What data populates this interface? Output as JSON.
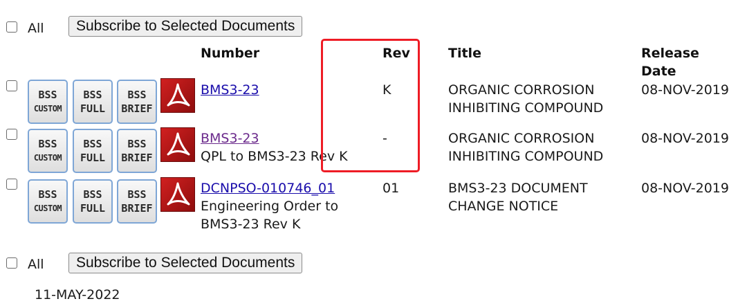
{
  "top": {
    "all_label": "All",
    "subscribe_label": "Subscribe to Selected Documents"
  },
  "headers": {
    "number": "Number",
    "rev": "Rev",
    "title": "Title",
    "release_date": "Release Date"
  },
  "bss_buttons": {
    "custom": {
      "line1": "BSS",
      "line2": "CUSTOM"
    },
    "full": {
      "line1": "BSS",
      "line2": "FULL"
    },
    "brief": {
      "line1": "BSS",
      "line2": "BRIEF"
    }
  },
  "rows": [
    {
      "number": "BMS3-23",
      "subtitle": "",
      "rev": "K",
      "title_line1": "ORGANIC CORROSION",
      "title_line2": "INHIBITING COMPOUND",
      "release_date": "08-NOV-2019"
    },
    {
      "number": "BMS3-23",
      "subtitle": "QPL to BMS3-23 Rev K",
      "rev": "-",
      "title_line1": "ORGANIC CORROSION",
      "title_line2": "INHIBITING COMPOUND",
      "release_date": "08-NOV-2019"
    },
    {
      "number": "DCNPSO-010746_01",
      "subtitle_line1": "Engineering Order to",
      "subtitle_line2": "BMS3-23 Rev K",
      "rev": "01",
      "title_line1": "BMS3-23 DOCUMENT",
      "title_line2": "CHANGE NOTICE",
      "release_date": "08-NOV-2019"
    }
  ],
  "bottom": {
    "all_label": "All",
    "subscribe_label": "Subscribe to Selected Documents",
    "date": "11-MAY-2022"
  },
  "colors": {
    "highlight": "#ee1c25",
    "link": "#1a0dab",
    "visited": "#6b2a8c"
  }
}
